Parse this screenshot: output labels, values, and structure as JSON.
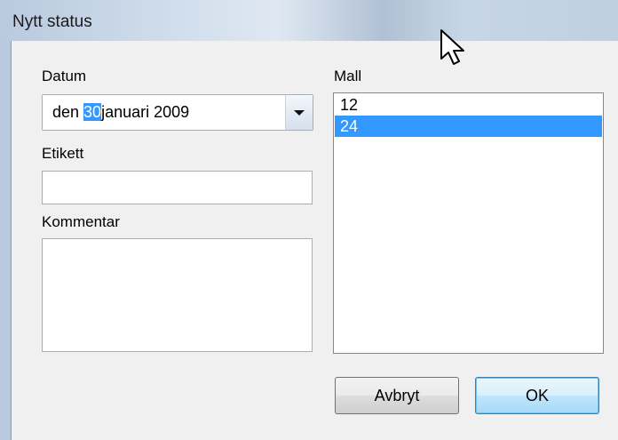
{
  "window": {
    "title": "Nytt status"
  },
  "form": {
    "date_label": "Datum",
    "date_value": {
      "prefix": "den ",
      "selected": "30",
      "suffix": "januari 2009"
    },
    "label_label": "Etikett",
    "label_value": "",
    "comment_label": "Kommentar",
    "comment_value": "",
    "template_label": "Mall",
    "template_items": [
      "12",
      "24"
    ],
    "template_selected": "24"
  },
  "buttons": {
    "cancel_label": "Avbryt",
    "ok_label": "OK"
  },
  "colors": {
    "selection": "#3399ff",
    "window_frame": "#c4d4e6"
  },
  "icons": {
    "cursor": "mouse-pointer-icon",
    "dropdown": "chevron-down-icon"
  }
}
